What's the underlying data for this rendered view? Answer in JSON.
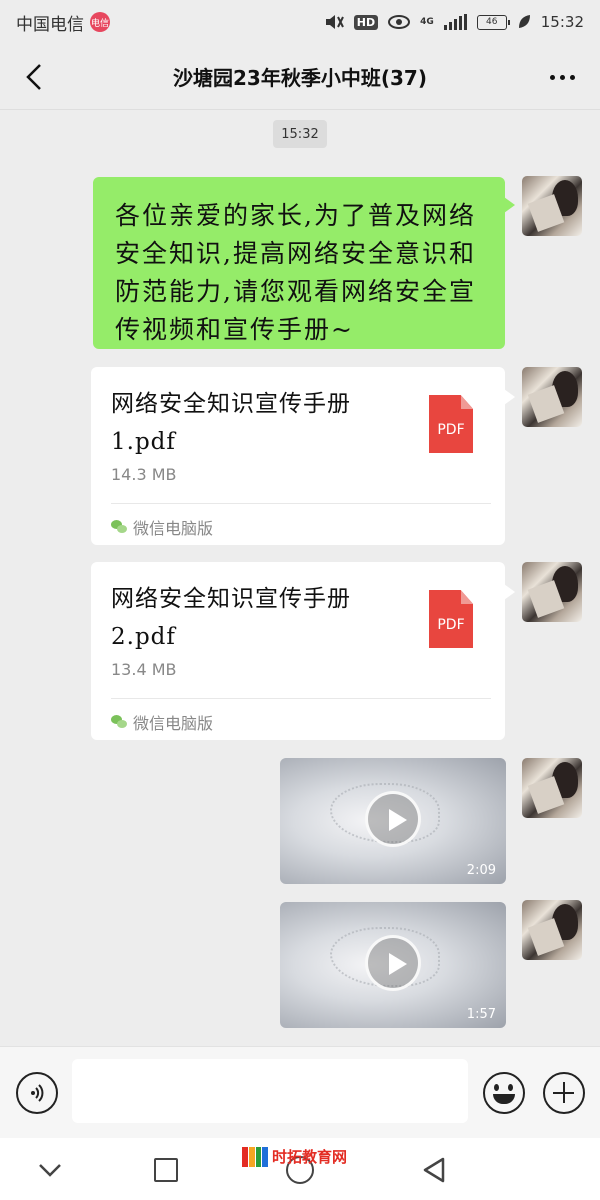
{
  "status_bar": {
    "carrier": "中国电信",
    "carrier_badge": "电信",
    "hd": "HD",
    "network": "4G",
    "battery": "46",
    "time": "15:32"
  },
  "header": {
    "title": "沙塘园23年秋季小中班(37)"
  },
  "chat": {
    "timestamp": "15:32",
    "messages": [
      {
        "type": "text",
        "text": "各位亲爱的家长,为了普及网络安全知识,提高网络安全意识和防范能力,请您观看网络安全宣传视频和宣传手册~"
      },
      {
        "type": "file",
        "name": "网络安全知识宣传手册1.pdf",
        "size": "14.3 MB",
        "file_icon": "PDF",
        "source": "微信电脑版"
      },
      {
        "type": "file",
        "name": "网络安全知识宣传手册2.pdf",
        "size": "13.4 MB",
        "file_icon": "PDF",
        "source": "微信电脑版"
      },
      {
        "type": "video",
        "duration": "2:09"
      },
      {
        "type": "video",
        "duration": "1:57"
      }
    ]
  },
  "input_bar": {
    "voice_icon": "voice-icon",
    "emoji_icon": "emoji-icon",
    "plus_icon": "plus-icon",
    "input_value": ""
  },
  "watermark": {
    "text": "时拓教育网"
  },
  "colors": {
    "bubble_green": "#95ec69",
    "background": "#ededed",
    "pdf_red": "#e8463f"
  }
}
